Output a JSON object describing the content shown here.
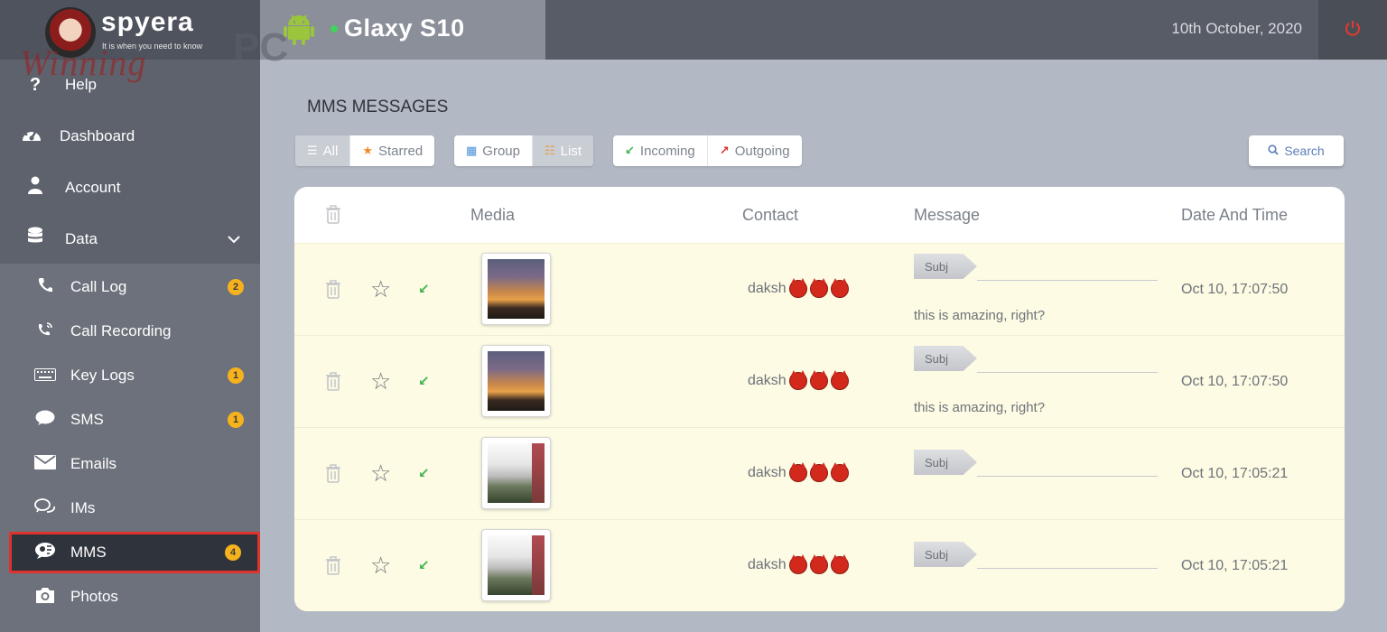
{
  "logo": {
    "name": "spyera",
    "tagline": "It is when you need to know"
  },
  "watermark": {
    "script": "Winning",
    "pc": "PC"
  },
  "sidebar": {
    "top_items": [
      {
        "label": "Help",
        "icon": "question-icon"
      },
      {
        "label": "Dashboard",
        "icon": "dashboard-icon"
      },
      {
        "label": "Account",
        "icon": "user-icon"
      },
      {
        "label": "Data",
        "icon": "database-icon"
      }
    ],
    "sub_items": [
      {
        "label": "Call Log",
        "icon": "phone-icon",
        "badge": "2"
      },
      {
        "label": "Call Recording",
        "icon": "phone-recording-icon",
        "badge": ""
      },
      {
        "label": "Key Logs",
        "icon": "keyboard-icon",
        "badge": "1"
      },
      {
        "label": "SMS",
        "icon": "chat-bubble-icon",
        "badge": "1"
      },
      {
        "label": "Emails",
        "icon": "envelope-icon",
        "badge": ""
      },
      {
        "label": "IMs",
        "icon": "im-icon",
        "badge": ""
      },
      {
        "label": "MMS",
        "icon": "mms-icon",
        "badge": "4"
      },
      {
        "label": "Photos",
        "icon": "camera-icon",
        "badge": ""
      }
    ]
  },
  "header": {
    "device_name": "Glaxy S10",
    "date": "10th October, 2020"
  },
  "page": {
    "title": "MMS MESSAGES",
    "filters": {
      "all": "All",
      "starred": "Starred",
      "group": "Group",
      "list": "List",
      "incoming": "Incoming",
      "outgoing": "Outgoing"
    },
    "search_label": "Search"
  },
  "table": {
    "columns": {
      "media": "Media",
      "contact": "Contact",
      "message": "Message",
      "datetime": "Date And Time"
    },
    "rows": [
      {
        "contact": "daksh",
        "subject": "Subj",
        "message": "this is amazing, right?",
        "datetime": "Oct 10, 17:07:50",
        "media": "sunset-photo"
      },
      {
        "contact": "daksh",
        "subject": "Subj",
        "message": "this is amazing, right?",
        "datetime": "Oct 10, 17:07:50",
        "media": "sunset-photo"
      },
      {
        "contact": "daksh",
        "subject": "Subj",
        "message": "",
        "datetime": "Oct 10, 17:05:21",
        "media": "fog-photo"
      },
      {
        "contact": "daksh",
        "subject": "Subj",
        "message": "",
        "datetime": "Oct 10, 17:05:21",
        "media": "fog-photo"
      }
    ]
  },
  "colors": {
    "accent_red": "#e0322c",
    "badge": "#f5b21c",
    "incoming_green": "#3fb34f",
    "outgoing_red": "#d9302b",
    "row_bg": "#fdfbe3"
  }
}
